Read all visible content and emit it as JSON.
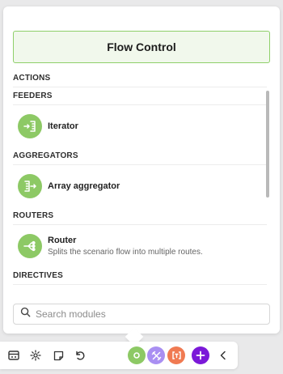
{
  "panel": {
    "title": "Flow Control",
    "sections": [
      {
        "label": "ACTIONS",
        "items": []
      },
      {
        "label": "FEEDERS",
        "items": [
          {
            "title": "Iterator",
            "desc": "",
            "icon": "iterator-icon"
          }
        ]
      },
      {
        "label": "AGGREGATORS",
        "items": [
          {
            "title": "Array aggregator",
            "desc": "",
            "icon": "array-aggregator-icon"
          }
        ]
      },
      {
        "label": "ROUTERS",
        "items": [
          {
            "title": "Router",
            "desc": "Splits the scenario flow into multiple routes.",
            "icon": "router-icon"
          }
        ]
      },
      {
        "label": "DIRECTIVES",
        "items": []
      }
    ],
    "module_icon_color": "#8dc965",
    "search": {
      "placeholder": "Search modules",
      "value": ""
    }
  },
  "toolbar": {
    "buttons": [
      "scheduling-icon",
      "settings-icon",
      "notes-icon",
      "undo-icon"
    ],
    "categories": [
      {
        "icon": "flow-control-icon",
        "color": "#8dc965"
      },
      {
        "icon": "tools-icon",
        "color": "#a98ff2"
      },
      {
        "icon": "text-parser-icon",
        "color": "#f07a52"
      },
      {
        "icon": "add-icon",
        "color": "#7b19d8"
      }
    ]
  }
}
